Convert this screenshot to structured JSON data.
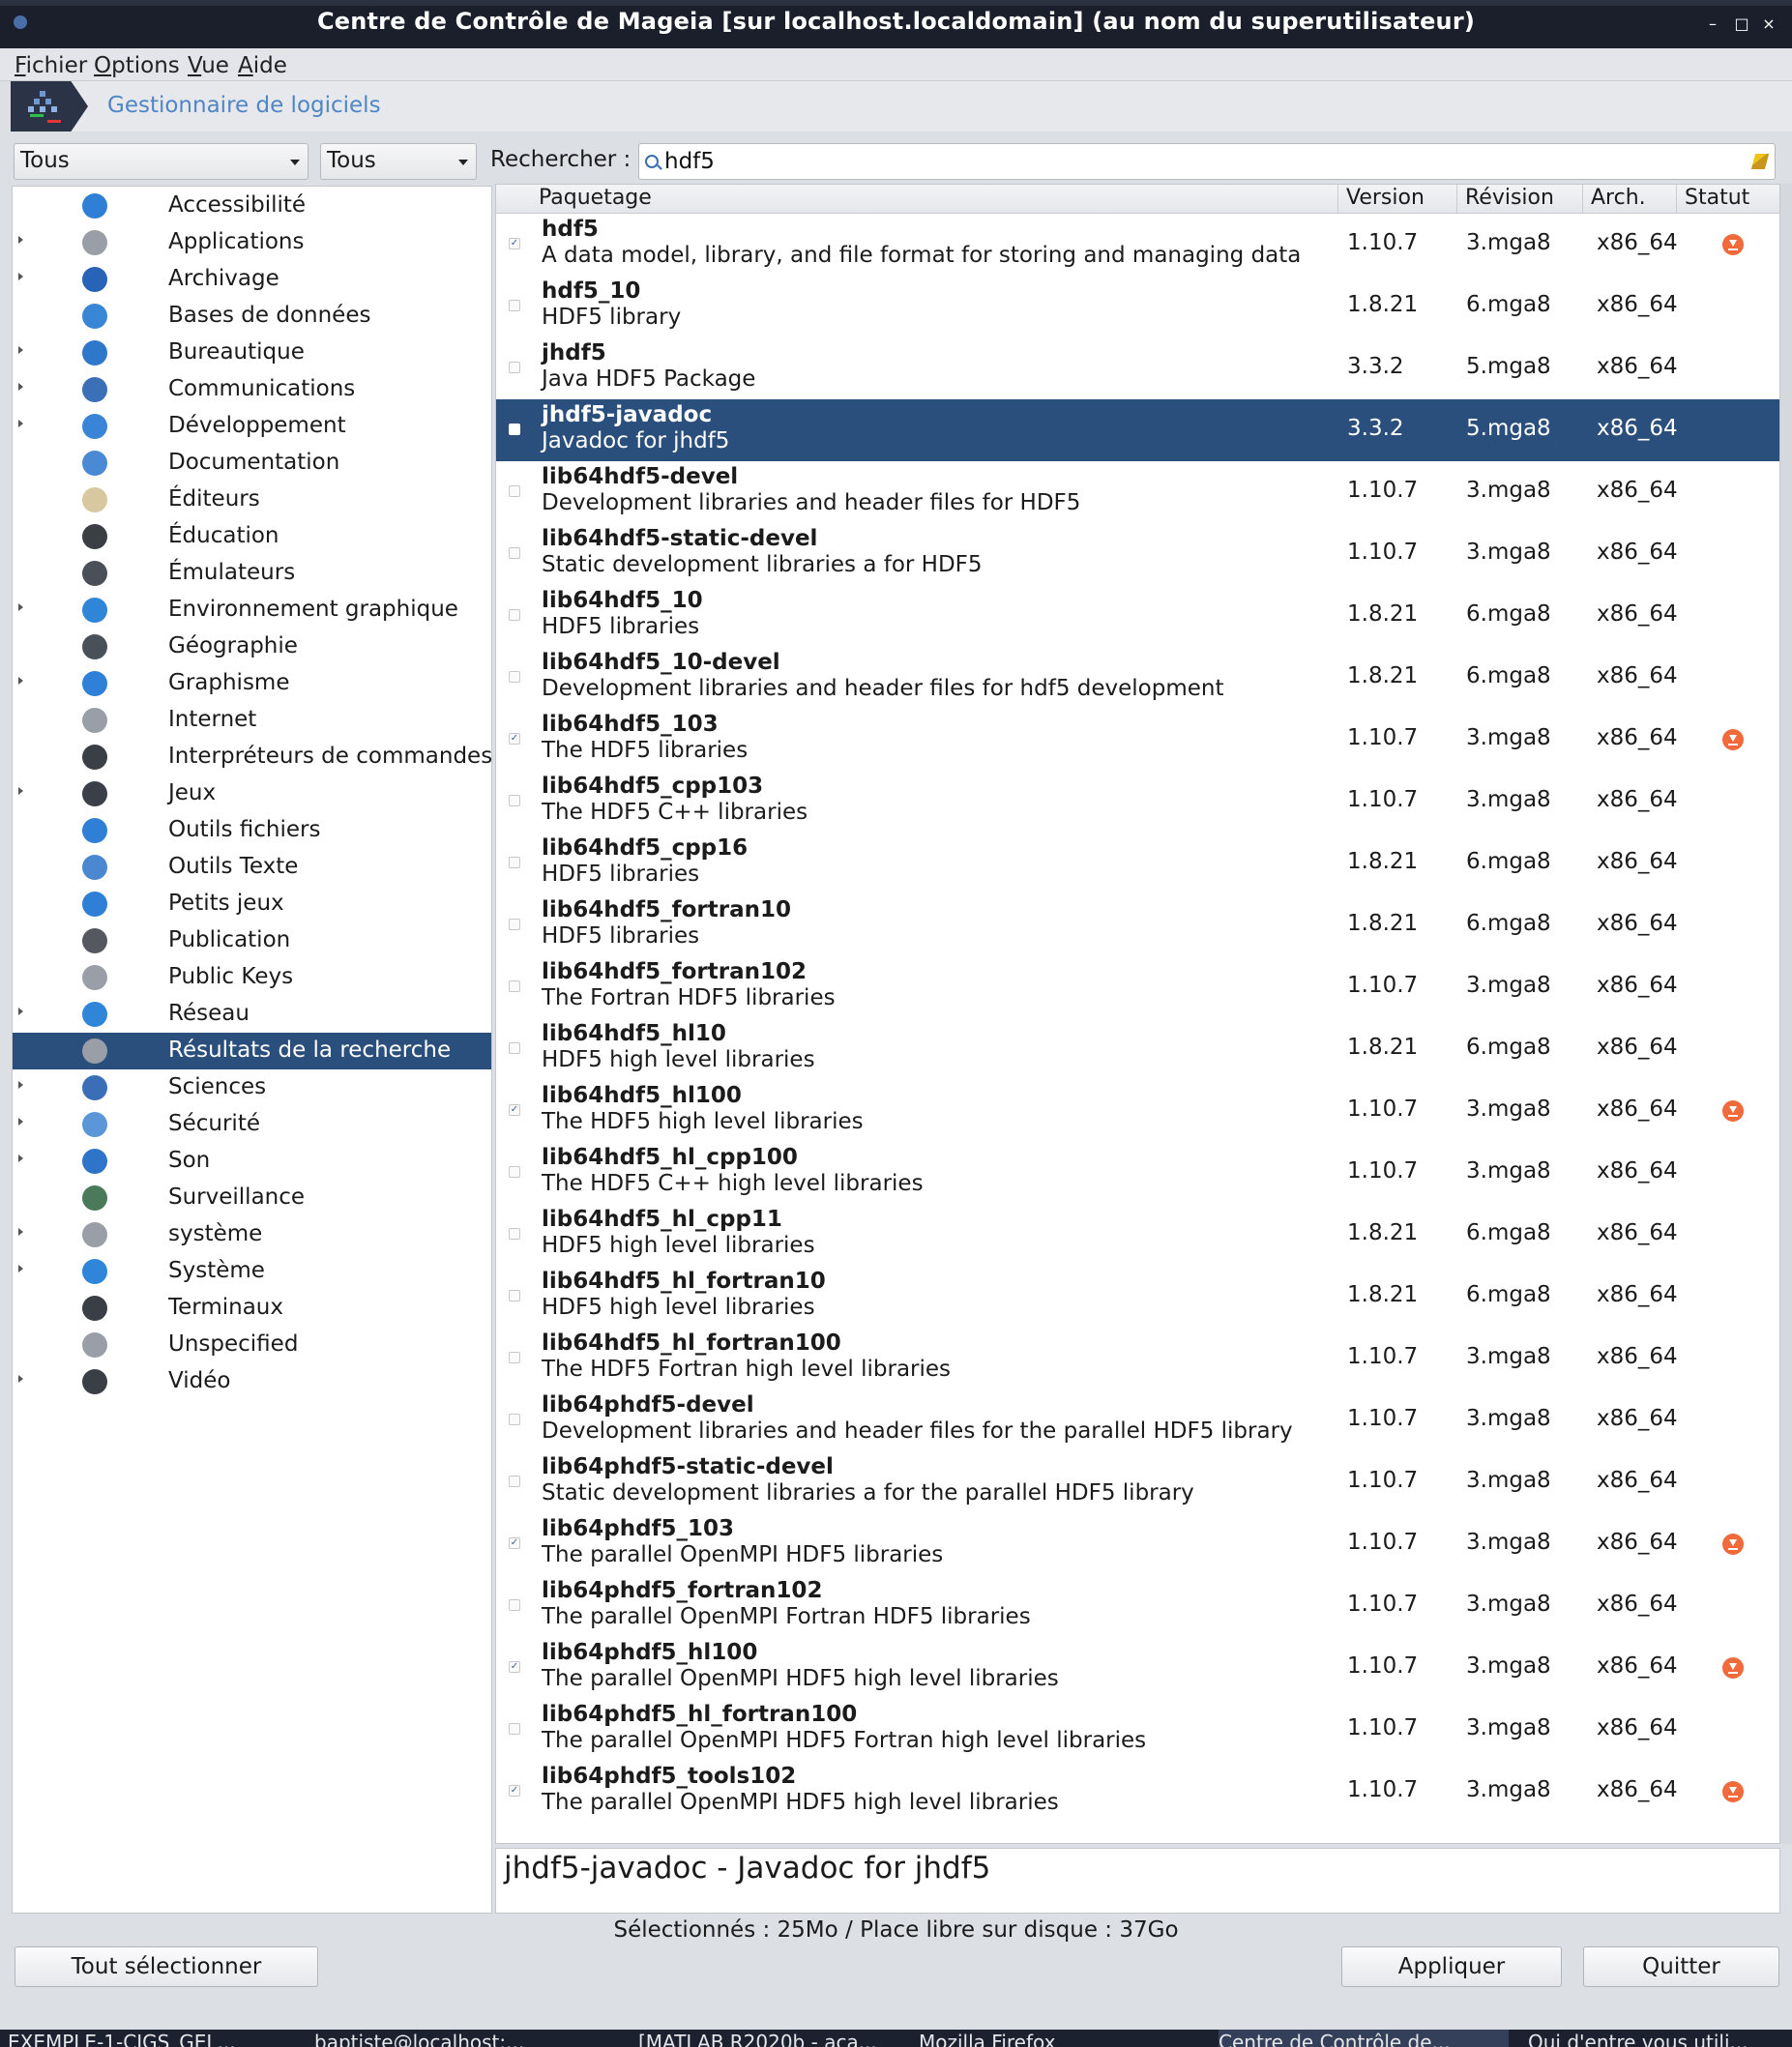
{
  "window": {
    "title": "Centre de Contrôle de Mageia  [sur localhost.localdomain] (au nom du superutilisateur)"
  },
  "menu": [
    "Fichier",
    "Options",
    "Vue",
    "Aide"
  ],
  "header": {
    "title": "Gestionnaire de logiciels"
  },
  "filters": {
    "type": "Tous",
    "status": "Tous",
    "search_label": "Rechercher :",
    "search_value": "hdf5"
  },
  "categories": [
    {
      "label": "Accessibilité",
      "expandable": false,
      "icon": "accessibility-icon",
      "color": "#2f7fd6"
    },
    {
      "label": "Applications",
      "expandable": true,
      "icon": "more-icon",
      "color": "#9a9ea6"
    },
    {
      "label": "Archivage",
      "expandable": true,
      "icon": "archive-icon",
      "color": "#2764b8"
    },
    {
      "label": "Bases de données",
      "expandable": false,
      "icon": "database-icon",
      "color": "#3a86d6"
    },
    {
      "label": "Bureautique",
      "expandable": true,
      "icon": "office-icon",
      "color": "#2e78cc"
    },
    {
      "label": "Communications",
      "expandable": true,
      "icon": "megaphone-icon",
      "color": "#3b6fb6"
    },
    {
      "label": "Développement",
      "expandable": true,
      "icon": "development-icon",
      "color": "#3a84d8"
    },
    {
      "label": "Documentation",
      "expandable": false,
      "icon": "doc-icon",
      "color": "#4a8ad4"
    },
    {
      "label": "Éditeurs",
      "expandable": false,
      "icon": "editor-icon",
      "color": "#d8c8a0"
    },
    {
      "label": "Éducation",
      "expandable": false,
      "icon": "blackboard-icon",
      "color": "#3b3f44"
    },
    {
      "label": "Émulateurs",
      "expandable": false,
      "icon": "gamepad-icon",
      "color": "#4a4f58"
    },
    {
      "label": "Environnement graphique",
      "expandable": true,
      "icon": "desktop-icon",
      "color": "#2f86d9"
    },
    {
      "label": "Géographie",
      "expandable": false,
      "icon": "globe-icon",
      "color": "#4a5058"
    },
    {
      "label": "Graphisme",
      "expandable": true,
      "icon": "graphics-icon",
      "color": "#2f80d8"
    },
    {
      "label": "Internet",
      "expandable": false,
      "icon": "more-icon",
      "color": "#9a9ea6"
    },
    {
      "label": "Interpréteurs de commandes",
      "expandable": false,
      "icon": "shell-icon",
      "color": "#3a3e45"
    },
    {
      "label": "Jeux",
      "expandable": true,
      "icon": "joystick-icon",
      "color": "#3b3f47"
    },
    {
      "label": "Outils fichiers",
      "expandable": false,
      "icon": "file-tools-icon",
      "color": "#2f7fd6"
    },
    {
      "label": "Outils Texte",
      "expandable": false,
      "icon": "text-tools-icon",
      "color": "#4b88cf"
    },
    {
      "label": "Petits jeux",
      "expandable": false,
      "icon": "ball-icon",
      "color": "#2f7fd6"
    },
    {
      "label": "Publication",
      "expandable": false,
      "icon": "printer-icon",
      "color": "#55595f"
    },
    {
      "label": "Public Keys",
      "expandable": false,
      "icon": "more-icon",
      "color": "#9a9ea6"
    },
    {
      "label": "Réseau",
      "expandable": true,
      "icon": "network-icon",
      "color": "#2f86d9"
    },
    {
      "label": "Résultats de la recherche",
      "expandable": false,
      "icon": "more-icon",
      "color": "#9a9ea6",
      "selected": true
    },
    {
      "label": "Sciences",
      "expandable": true,
      "icon": "flask-icon",
      "color": "#3a6fb7"
    },
    {
      "label": "Sécurité",
      "expandable": true,
      "icon": "lock-icon",
      "color": "#5b97d8"
    },
    {
      "label": "Son",
      "expandable": true,
      "icon": "headphones-icon",
      "color": "#2e74c8"
    },
    {
      "label": "Surveillance",
      "expandable": false,
      "icon": "monitor-chart-icon",
      "color": "#4a7a5a"
    },
    {
      "label": "système",
      "expandable": true,
      "icon": "more-icon",
      "color": "#9a9ea6"
    },
    {
      "label": "Système",
      "expandable": true,
      "icon": "settings-icon",
      "color": "#2f86d9"
    },
    {
      "label": "Terminaux",
      "expandable": false,
      "icon": "terminal-icon",
      "color": "#3a3e45"
    },
    {
      "label": "Unspecified",
      "expandable": false,
      "icon": "more-icon",
      "color": "#9a9ea6"
    },
    {
      "label": "Vidéo",
      "expandable": true,
      "icon": "video-icon",
      "color": "#3a3e45"
    }
  ],
  "table": {
    "columns": [
      "Paquetage",
      "Version",
      "Révision",
      "Arch.",
      "Statut"
    ],
    "rows": [
      {
        "name": "hdf5",
        "desc": "A data model, library, and file format for storing and managing data",
        "version": "1.10.7",
        "revision": "3.mga8",
        "arch": "x86_64",
        "checked": true,
        "installed": true
      },
      {
        "name": "hdf5_10",
        "desc": "HDF5 library",
        "version": "1.8.21",
        "revision": "6.mga8",
        "arch": "x86_64",
        "checked": false,
        "installed": false
      },
      {
        "name": "jhdf5",
        "desc": "Java HDF5 Package",
        "version": "3.3.2",
        "revision": "5.mga8",
        "arch": "x86_64",
        "checked": false,
        "installed": false
      },
      {
        "name": "jhdf5-javadoc",
        "desc": "Javadoc for jhdf5",
        "version": "3.3.2",
        "revision": "5.mga8",
        "arch": "x86_64",
        "checked": false,
        "installed": false,
        "selected": true
      },
      {
        "name": "lib64hdf5-devel",
        "desc": "Development libraries and header files for HDF5",
        "version": "1.10.7",
        "revision": "3.mga8",
        "arch": "x86_64",
        "checked": false,
        "installed": false
      },
      {
        "name": "lib64hdf5-static-devel",
        "desc": "Static development libraries a for HDF5",
        "version": "1.10.7",
        "revision": "3.mga8",
        "arch": "x86_64",
        "checked": false,
        "installed": false
      },
      {
        "name": "lib64hdf5_10",
        "desc": "HDF5 libraries",
        "version": "1.8.21",
        "revision": "6.mga8",
        "arch": "x86_64",
        "checked": false,
        "installed": false
      },
      {
        "name": "lib64hdf5_10-devel",
        "desc": "Development libraries and header files for hdf5 development",
        "version": "1.8.21",
        "revision": "6.mga8",
        "arch": "x86_64",
        "checked": false,
        "installed": false
      },
      {
        "name": "lib64hdf5_103",
        "desc": "The HDF5 libraries",
        "version": "1.10.7",
        "revision": "3.mga8",
        "arch": "x86_64",
        "checked": true,
        "installed": true
      },
      {
        "name": "lib64hdf5_cpp103",
        "desc": "The HDF5 C++ libraries",
        "version": "1.10.7",
        "revision": "3.mga8",
        "arch": "x86_64",
        "checked": false,
        "installed": false
      },
      {
        "name": "lib64hdf5_cpp16",
        "desc": "HDF5 libraries",
        "version": "1.8.21",
        "revision": "6.mga8",
        "arch": "x86_64",
        "checked": false,
        "installed": false
      },
      {
        "name": "lib64hdf5_fortran10",
        "desc": "HDF5 libraries",
        "version": "1.8.21",
        "revision": "6.mga8",
        "arch": "x86_64",
        "checked": false,
        "installed": false
      },
      {
        "name": "lib64hdf5_fortran102",
        "desc": "The Fortran HDF5 libraries",
        "version": "1.10.7",
        "revision": "3.mga8",
        "arch": "x86_64",
        "checked": false,
        "installed": false
      },
      {
        "name": "lib64hdf5_hl10",
        "desc": "HDF5 high level libraries",
        "version": "1.8.21",
        "revision": "6.mga8",
        "arch": "x86_64",
        "checked": false,
        "installed": false
      },
      {
        "name": "lib64hdf5_hl100",
        "desc": "The HDF5 high level libraries",
        "version": "1.10.7",
        "revision": "3.mga8",
        "arch": "x86_64",
        "checked": true,
        "installed": true
      },
      {
        "name": "lib64hdf5_hl_cpp100",
        "desc": "The HDF5 C++ high level libraries",
        "version": "1.10.7",
        "revision": "3.mga8",
        "arch": "x86_64",
        "checked": false,
        "installed": false
      },
      {
        "name": "lib64hdf5_hl_cpp11",
        "desc": "HDF5 high level libraries",
        "version": "1.8.21",
        "revision": "6.mga8",
        "arch": "x86_64",
        "checked": false,
        "installed": false
      },
      {
        "name": "lib64hdf5_hl_fortran10",
        "desc": "HDF5 high level libraries",
        "version": "1.8.21",
        "revision": "6.mga8",
        "arch": "x86_64",
        "checked": false,
        "installed": false
      },
      {
        "name": "lib64hdf5_hl_fortran100",
        "desc": "The HDF5 Fortran high level libraries",
        "version": "1.10.7",
        "revision": "3.mga8",
        "arch": "x86_64",
        "checked": false,
        "installed": false
      },
      {
        "name": "lib64phdf5-devel",
        "desc": "Development libraries and header files for the parallel HDF5 library",
        "version": "1.10.7",
        "revision": "3.mga8",
        "arch": "x86_64",
        "checked": false,
        "installed": false
      },
      {
        "name": "lib64phdf5-static-devel",
        "desc": "Static development libraries a for the parallel HDF5 library",
        "version": "1.10.7",
        "revision": "3.mga8",
        "arch": "x86_64",
        "checked": false,
        "installed": false
      },
      {
        "name": "lib64phdf5_103",
        "desc": "The parallel OpenMPI HDF5 libraries",
        "version": "1.10.7",
        "revision": "3.mga8",
        "arch": "x86_64",
        "checked": true,
        "installed": true
      },
      {
        "name": "lib64phdf5_fortran102",
        "desc": "The parallel OpenMPI Fortran HDF5 libraries",
        "version": "1.10.7",
        "revision": "3.mga8",
        "arch": "x86_64",
        "checked": false,
        "installed": false
      },
      {
        "name": "lib64phdf5_hl100",
        "desc": "The parallel OpenMPI HDF5 high level libraries",
        "version": "1.10.7",
        "revision": "3.mga8",
        "arch": "x86_64",
        "checked": true,
        "installed": true
      },
      {
        "name": "lib64phdf5_hl_fortran100",
        "desc": "The parallel OpenMPI HDF5 Fortran high level libraries",
        "version": "1.10.7",
        "revision": "3.mga8",
        "arch": "x86_64",
        "checked": false,
        "installed": false
      },
      {
        "name": "lib64phdf5_tools102",
        "desc": "The parallel OpenMPI HDF5 high level libraries",
        "version": "1.10.7",
        "revision": "3.mga8",
        "arch": "x86_64",
        "checked": true,
        "installed": true
      }
    ]
  },
  "description": "jhdf5-javadoc - Javadoc for jhdf5",
  "status": "Sélectionnés : 25Mo / Place libre sur disque : 37Go",
  "buttons": {
    "select_all": "Tout sélectionner",
    "apply": "Appliquer",
    "quit": "Quitter"
  },
  "taskbar": [
    "EXEMPLE-1-CIGS_GEL...",
    "baptiste@localhost:...",
    "[MATLAB R2020b - aca...",
    "Mozilla Firefox",
    "Centre de Contrôle de...",
    "Qui d'entre vous utili..."
  ],
  "colors": {
    "selection": "#2a4f7c",
    "accent": "#4f86c6",
    "status_installed": "#f06a3c"
  }
}
